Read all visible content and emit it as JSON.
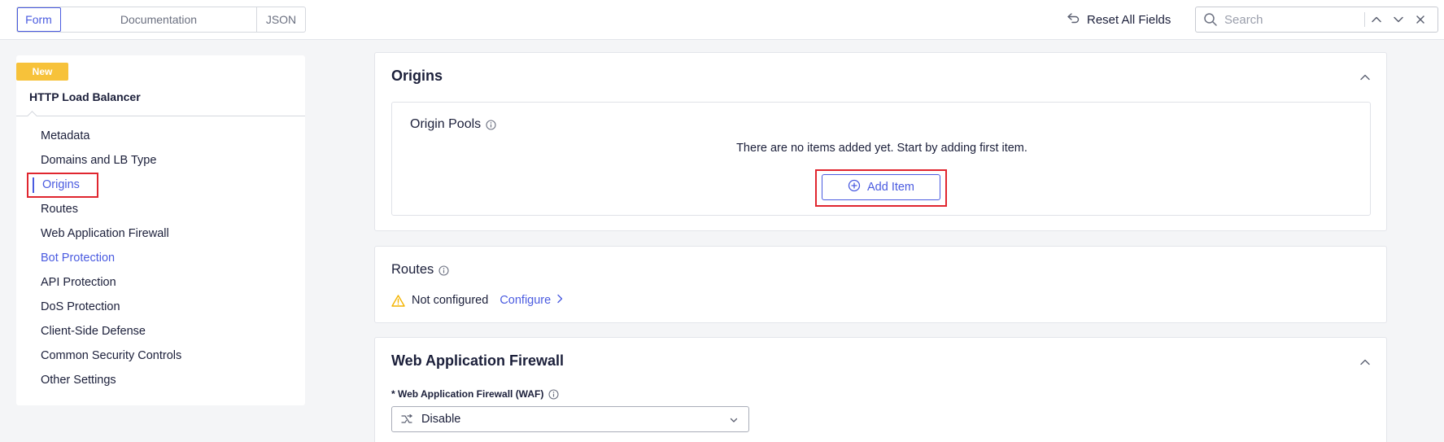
{
  "topbar": {
    "tabs": [
      {
        "label": "Form",
        "active": true
      },
      {
        "label": "Documentation",
        "active": false
      },
      {
        "label": "JSON",
        "active": false
      }
    ],
    "reset_label": "Reset All Fields",
    "search_placeholder": "Search",
    "icons": [
      "undo-icon",
      "search-icon",
      "chevron-up-icon",
      "chevron-down-icon",
      "close-icon"
    ]
  },
  "sidebar": {
    "badge": "New",
    "title": "HTTP Load Balancer",
    "items": [
      {
        "label": "Metadata"
      },
      {
        "label": "Domains and LB Type"
      },
      {
        "label": "Origins",
        "active": true
      },
      {
        "label": "Routes"
      },
      {
        "label": "Web Application Firewall"
      },
      {
        "label": "Bot Protection",
        "link": true
      },
      {
        "label": "API Protection"
      },
      {
        "label": "DoS Protection"
      },
      {
        "label": "Client-Side Defense"
      },
      {
        "label": "Common Security Controls"
      },
      {
        "label": "Other Settings"
      }
    ]
  },
  "origins": {
    "title": "Origins",
    "pools_label": "Origin Pools",
    "empty_message": "There are no items added yet. Start by adding first item.",
    "add_item_label": "Add Item"
  },
  "routes": {
    "title": "Routes",
    "status": "Not configured",
    "configure_label": "Configure"
  },
  "waf": {
    "title": "Web Application Firewall",
    "field_label": "* Web Application Firewall (WAF)",
    "selected_value": "Disable"
  },
  "colors": {
    "accent": "#4a5be0",
    "badge": "#f7c23a",
    "highlight": "#e0262f",
    "warning": "#f4b400"
  }
}
